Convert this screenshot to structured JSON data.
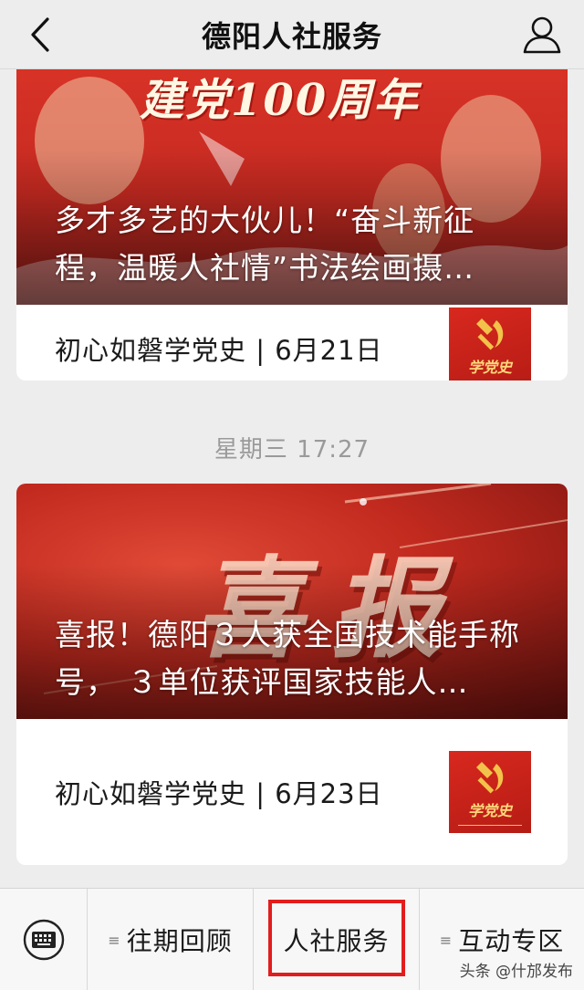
{
  "header": {
    "title": "德阳人社服务",
    "back_icon": "chevron-left-icon",
    "user_icon": "user-profile-icon"
  },
  "feed": {
    "cards": [
      {
        "banner_text": "建党100周年",
        "headline": "多才多艺的大伙儿！“奋斗新征程，温暖人社情”书法绘画摄…",
        "sub_title": "初心如磐学党史 | 6月21日",
        "thumb_label": "学党史"
      },
      {
        "banner_text": "喜报",
        "headline": "喜报！德阳３人获全国技术能手称号， ３单位获评国家技能人…",
        "sub_title": "初心如磐学党史 | 6月23日",
        "thumb_label": "学党史"
      }
    ],
    "timestamp": "星期三 17:27"
  },
  "menu": {
    "keyboard_icon": "keyboard-icon",
    "items": [
      {
        "label": "往期回顾",
        "icon": "menu-list-icon"
      },
      {
        "label": "人社服务"
      },
      {
        "label": "互动专区",
        "icon": "menu-list-icon"
      }
    ]
  },
  "watermark": "头条 @什邡发布",
  "colors": {
    "highlight": "#e21d1d",
    "banner_red": "#c62a21",
    "background": "#ededed"
  }
}
